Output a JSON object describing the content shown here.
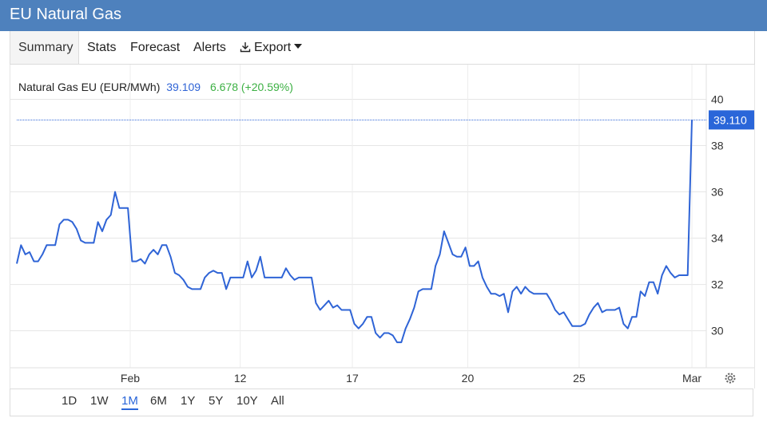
{
  "header": {
    "title": "EU Natural Gas"
  },
  "tabs": [
    {
      "label": "Summary",
      "active": true
    },
    {
      "label": "Stats",
      "active": false
    },
    {
      "label": "Forecast",
      "active": false
    },
    {
      "label": "Alerts",
      "active": false
    },
    {
      "label": "Export",
      "active": false
    }
  ],
  "quote": {
    "name": "Natural Gas EU (EUR/MWh)",
    "last": "39.109",
    "change": "6.678 (+20.59%)"
  },
  "last_price_tag": "39.110",
  "ranges": [
    "1D",
    "1W",
    "1M",
    "6M",
    "1Y",
    "5Y",
    "10Y",
    "All"
  ],
  "active_range": "1M",
  "colors": {
    "header_bg": "#4e81bd",
    "line": "#2f64d6",
    "quote_name": "#222222",
    "quote_last": "#2f64d6",
    "quote_change": "#3cb043",
    "price_tag_bg": "#2a66d9"
  },
  "icons": {
    "export": "download-icon",
    "settings": "gear-icon"
  },
  "chart_data": {
    "type": "line",
    "series": [
      {
        "name": "Natural Gas EU (EUR/MWh)",
        "values": [
          32.9,
          33.7,
          33.3,
          33.4,
          33.0,
          33.0,
          33.3,
          33.7,
          33.7,
          33.7,
          34.6,
          34.8,
          34.8,
          34.7,
          34.4,
          33.9,
          33.8,
          33.8,
          33.8,
          34.7,
          34.3,
          34.8,
          35.0,
          36.0,
          35.3,
          35.3,
          35.3,
          33.0,
          33.0,
          33.1,
          32.9,
          33.3,
          33.5,
          33.3,
          33.7,
          33.7,
          33.2,
          32.5,
          32.4,
          32.2,
          31.9,
          31.8,
          31.8,
          31.8,
          32.3,
          32.5,
          32.6,
          32.5,
          32.5,
          31.8,
          32.3,
          32.3,
          32.3,
          32.3,
          33.0,
          32.3,
          32.6,
          33.2,
          32.3,
          32.3,
          32.3,
          32.3,
          32.3,
          32.7,
          32.4,
          32.2,
          32.3,
          32.3,
          32.3,
          32.3,
          31.2,
          30.9,
          31.1,
          31.3,
          31.0,
          31.1,
          30.9,
          30.9,
          30.9,
          30.3,
          30.1,
          30.3,
          30.6,
          30.6,
          29.9,
          29.7,
          29.9,
          29.9,
          29.8,
          29.5,
          29.5,
          30.1,
          30.5,
          31.0,
          31.7,
          31.8,
          31.8,
          31.8,
          32.8,
          33.3,
          34.3,
          33.8,
          33.3,
          33.2,
          33.2,
          33.6,
          32.8,
          32.8,
          33.0,
          32.3,
          31.9,
          31.6,
          31.6,
          31.5,
          31.6,
          30.8,
          31.7,
          31.9,
          31.6,
          31.9,
          31.7,
          31.6,
          31.6,
          31.6,
          31.6,
          31.3,
          30.9,
          30.7,
          30.8,
          30.5,
          30.2,
          30.2,
          30.2,
          30.3,
          30.7,
          31.0,
          31.2,
          30.8,
          30.9,
          30.9,
          30.9,
          31.0,
          30.3,
          30.1,
          30.6,
          30.6,
          31.7,
          31.5,
          32.1,
          32.1,
          31.6,
          32.4,
          32.8,
          32.5,
          32.3,
          32.4,
          32.4,
          32.4,
          39.11
        ]
      }
    ],
    "x_ticks": [
      "Feb",
      "12",
      "17",
      "20",
      "25",
      "Mar"
    ],
    "y_ticks": [
      30,
      32,
      34,
      36,
      38,
      40
    ],
    "ylim": [
      28.4,
      41.5
    ],
    "last_value": 39.11,
    "grid": true,
    "title": "",
    "xlabel": "",
    "ylabel": ""
  }
}
